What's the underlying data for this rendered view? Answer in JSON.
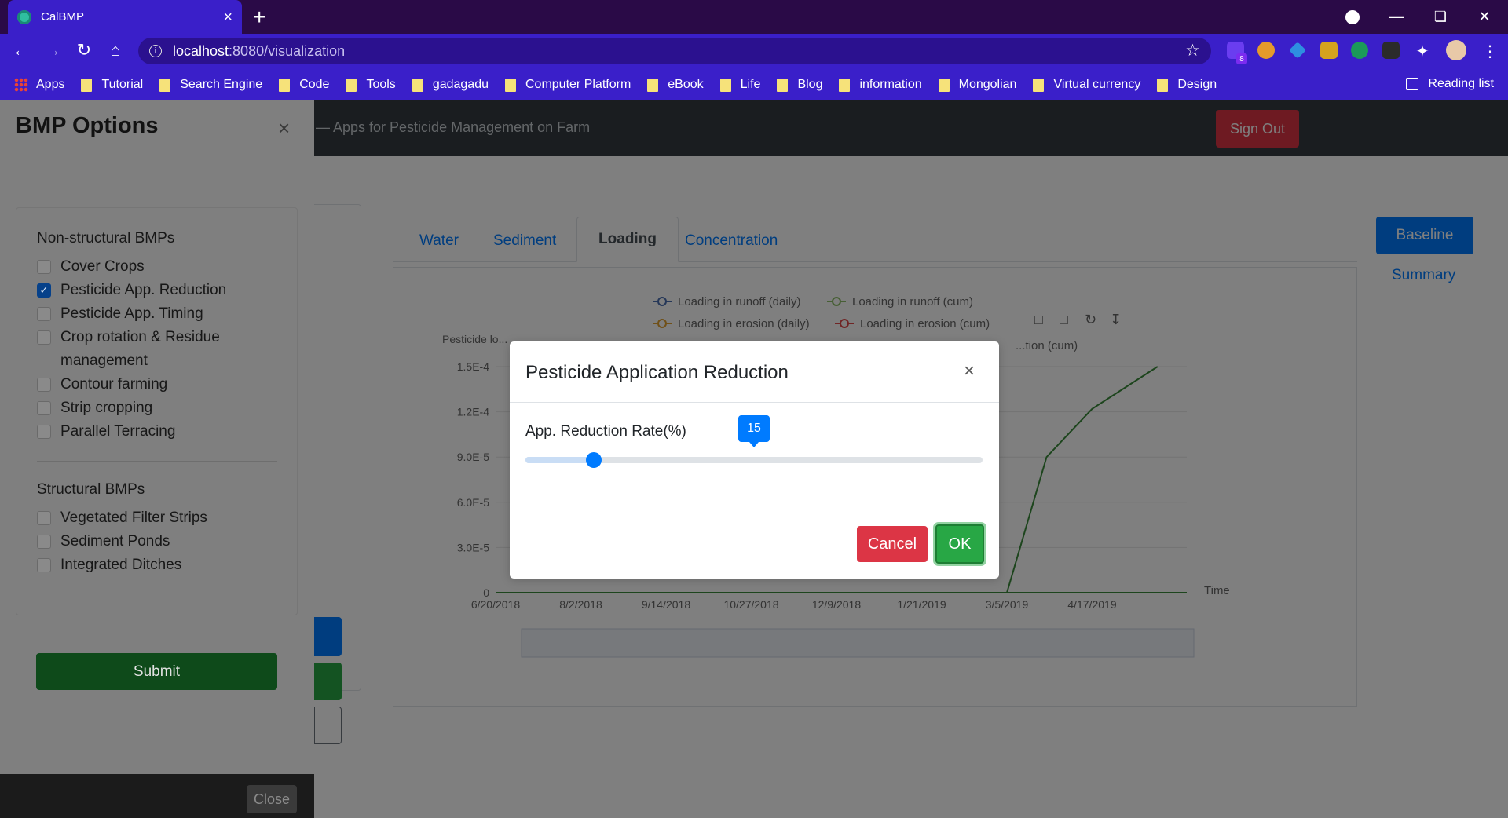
{
  "browser": {
    "tab_title": "CalBMP",
    "tab_close": "×",
    "new_tab": "+",
    "url_host": "localhost",
    "url_path": ":8080/visualization",
    "extension_badge": "8",
    "bookmarks": [
      "Apps",
      "Tutorial",
      "Search Engine",
      "Code",
      "Tools",
      "gadagadu",
      "Computer Platform",
      "eBook",
      "Life",
      "Blog",
      "information",
      "Mongolian",
      "Virtual currency",
      "Design"
    ],
    "reading_list": "Reading list"
  },
  "app": {
    "brand": "— Apps for Pesticide Management on Farm",
    "sign_out": "Sign Out",
    "tabs": [
      "Water",
      "Sediment",
      "Loading",
      "Concentration"
    ],
    "active_tab": "Loading",
    "baseline_button": "Baseline",
    "summary_link": "Summary"
  },
  "chart_data": {
    "type": "line",
    "title": "",
    "ylabel": "Pesticide lo...",
    "xlabel": "Time",
    "y_ticks": [
      "0",
      "3.0E-5",
      "6.0E-5",
      "9.0E-5",
      "1.2E-4",
      "1.5E-4"
    ],
    "x_ticks": [
      "6/20/2018",
      "8/2/2018",
      "9/14/2018",
      "10/27/2018",
      "12/9/2018",
      "1/21/2019",
      "3/5/2019",
      "4/17/2019"
    ],
    "legend": [
      "Loading in runoff (daily)",
      "Loading in runoff (cum)",
      "Loading in erosion (daily)",
      "Loading in erosion (cum)",
      "...tion (cum)"
    ],
    "series": [
      {
        "name": "Loading in runoff (cum)",
        "color": "#3a8a3a",
        "x": [
          "6/20/2018",
          "3/5/2019",
          "3/25/2019",
          "4/17/2019",
          "5/20/2019"
        ],
        "values": [
          0,
          0,
          9e-05,
          0.000122,
          0.00015
        ]
      }
    ],
    "legend_position": "top",
    "grid": true
  },
  "offcanvas": {
    "title": "BMP Options",
    "close": "×",
    "nonstructural_title": "Non-structural BMPs",
    "nonstructural": [
      {
        "label": "Cover Crops",
        "checked": false
      },
      {
        "label": "Pesticide App. Reduction",
        "checked": true
      },
      {
        "label": "Pesticide App. Timing",
        "checked": false
      },
      {
        "label": "Crop rotation & Residue management",
        "checked": false
      },
      {
        "label": "Contour farming",
        "checked": false
      },
      {
        "label": "Strip cropping",
        "checked": false
      },
      {
        "label": "Parallel Terracing",
        "checked": false
      }
    ],
    "structural_title": "Structural BMPs",
    "structural": [
      {
        "label": "Vegetated Filter Strips",
        "checked": false
      },
      {
        "label": "Sediment Ponds",
        "checked": false
      },
      {
        "label": "Integrated Ditches",
        "checked": false
      }
    ],
    "submit": "Submit",
    "close_button": "Close"
  },
  "modal": {
    "title": "Pesticide Application Reduction",
    "close": "×",
    "slider_label": "App. Reduction Rate(%)",
    "slider_value": "15",
    "slider_min": 0,
    "slider_max": 100,
    "cancel": "Cancel",
    "ok": "OK"
  },
  "colors": {
    "browser_chrome": "#3a1fc9",
    "primary": "#007bff",
    "danger": "#dc3545",
    "success": "#28a745"
  }
}
